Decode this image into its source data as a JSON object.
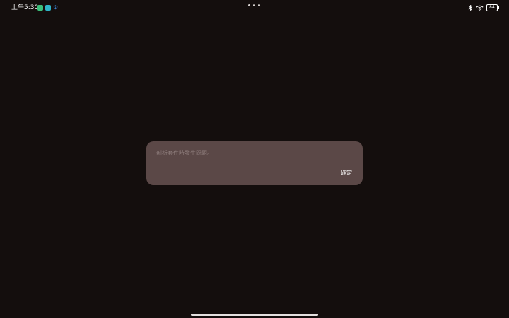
{
  "status_bar": {
    "time": "上午5:30",
    "notification_icons": [
      "green-app-icon",
      "teal-app-icon",
      "gear-icon"
    ],
    "right_icons": [
      "bluetooth-icon",
      "wifi-icon"
    ],
    "battery_level": "84"
  },
  "dialog": {
    "message": "剖析套件時發生問題。",
    "ok_label": "確定"
  },
  "colors": {
    "background": "#140e0d",
    "dialog_background": "#5b4847",
    "message_text": "#8d7c7b",
    "button_text": "#ffffff"
  }
}
